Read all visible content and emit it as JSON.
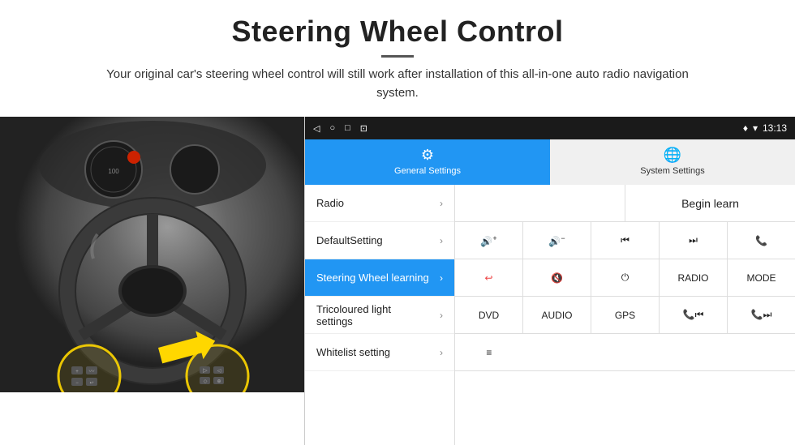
{
  "header": {
    "title": "Steering Wheel Control",
    "subtitle": "Your original car's steering wheel control will still work after installation of this all-in-one auto radio navigation system."
  },
  "status_bar": {
    "back_icon": "◁",
    "home_icon": "○",
    "recent_icon": "□",
    "screenshot_icon": "⊡",
    "wifi_icon": "▾",
    "signal_icon": "▾",
    "time": "13:13"
  },
  "tabs": [
    {
      "id": "general",
      "label": "General Settings",
      "icon": "⚙",
      "active": true
    },
    {
      "id": "system",
      "label": "System Settings",
      "icon": "🌐",
      "active": false
    }
  ],
  "menu_items": [
    {
      "label": "Radio",
      "active": false
    },
    {
      "label": "DefaultSetting",
      "active": false
    },
    {
      "label": "Steering Wheel learning",
      "active": true
    },
    {
      "label": "Tricoloured light settings",
      "active": false
    },
    {
      "label": "Whitelist setting",
      "active": false
    }
  ],
  "button_rows": [
    {
      "row": 1,
      "cells": [
        {
          "type": "empty"
        },
        {
          "type": "button",
          "label": "Begin learn",
          "span": 1
        }
      ]
    },
    {
      "row": 2,
      "cells": [
        {
          "type": "icon",
          "label": "🔊+"
        },
        {
          "type": "icon",
          "label": "🔊−"
        },
        {
          "type": "icon",
          "label": "⏮"
        },
        {
          "type": "icon",
          "label": "⏭"
        },
        {
          "type": "icon",
          "label": "📞"
        }
      ]
    },
    {
      "row": 3,
      "cells": [
        {
          "type": "icon",
          "label": "↩"
        },
        {
          "type": "icon",
          "label": "🔊✕"
        },
        {
          "type": "icon",
          "label": "⏻"
        },
        {
          "type": "button",
          "label": "RADIO"
        },
        {
          "type": "button",
          "label": "MODE"
        }
      ]
    },
    {
      "row": 4,
      "cells": [
        {
          "type": "button",
          "label": "DVD"
        },
        {
          "type": "button",
          "label": "AUDIO"
        },
        {
          "type": "button",
          "label": "GPS"
        },
        {
          "type": "icon",
          "label": "📞⏮"
        },
        {
          "type": "icon",
          "label": "📞⏭"
        }
      ]
    },
    {
      "row": 5,
      "cells": [
        {
          "type": "icon",
          "label": "≡"
        }
      ]
    }
  ]
}
